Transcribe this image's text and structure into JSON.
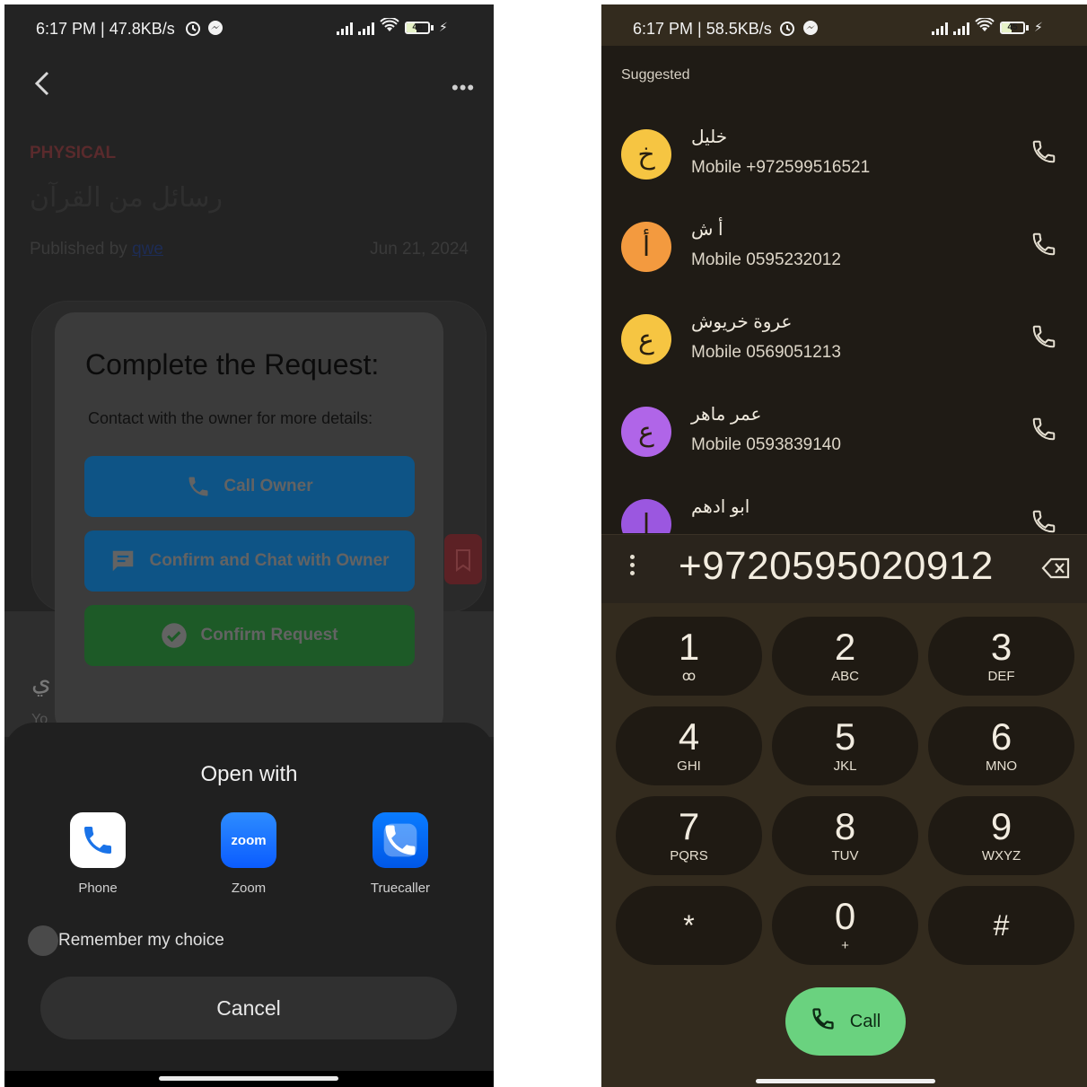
{
  "left": {
    "status": {
      "time": "6:17 PM | 47.8KB/s",
      "battery": "46"
    },
    "post": {
      "category": "PHYSICAL",
      "title": "رسائل من القرآن",
      "published_prefix": "Published by ",
      "publisher": "qwe",
      "date": "Jun 21, 2024",
      "bg_fragment": "ي",
      "bg_fragment2": "Yo"
    },
    "dialog": {
      "title": "Complete the Request:",
      "subtitle": "Contact with the owner for more details:",
      "call_label": "Call Owner",
      "chat_label": "Confirm and Chat with Owner",
      "confirm_label": "Confirm Request"
    },
    "sheet": {
      "title": "Open with",
      "apps": [
        {
          "label": "Phone",
          "icon": "phone-app-icon"
        },
        {
          "label": "Zoom",
          "icon": "zoom-app-icon",
          "icon_text": "zoom"
        },
        {
          "label": "Truecaller",
          "icon": "truecaller-app-icon"
        }
      ],
      "remember": "Remember my choice",
      "cancel": "Cancel"
    }
  },
  "right": {
    "status": {
      "time": "6:17 PM | 58.5KB/s",
      "battery": "45"
    },
    "suggested": "Suggested",
    "contacts": [
      {
        "initial": "خ",
        "name": "خليل",
        "number": "Mobile +972599516521",
        "color": "#f6c542"
      },
      {
        "initial": "أ",
        "name": "أ ش",
        "number": "Mobile 0595232012",
        "color": "#f39a3f"
      },
      {
        "initial": "ع",
        "name": "عروة خريوش",
        "number": "Mobile 0569051213",
        "color": "#f6c542"
      },
      {
        "initial": "ع",
        "name": "عمر ماهر",
        "number": "Mobile 0593839140",
        "color": "#b065e8"
      },
      {
        "initial": "ا",
        "name": "ابو ادهم",
        "number": "",
        "color": "#9b57e0"
      }
    ],
    "dialed": "+9720595020912",
    "keys": [
      {
        "digit": "1",
        "letters": "ꝏ"
      },
      {
        "digit": "2",
        "letters": "ABC"
      },
      {
        "digit": "3",
        "letters": "DEF"
      },
      {
        "digit": "4",
        "letters": "GHI"
      },
      {
        "digit": "5",
        "letters": "JKL"
      },
      {
        "digit": "6",
        "letters": "MNO"
      },
      {
        "digit": "7",
        "letters": "PQRS"
      },
      {
        "digit": "8",
        "letters": "TUV"
      },
      {
        "digit": "9",
        "letters": "WXYZ"
      },
      {
        "digit": "*",
        "letters": ""
      },
      {
        "digit": "0",
        "letters": "+"
      },
      {
        "digit": "#",
        "letters": ""
      }
    ],
    "call_label": "Call"
  }
}
